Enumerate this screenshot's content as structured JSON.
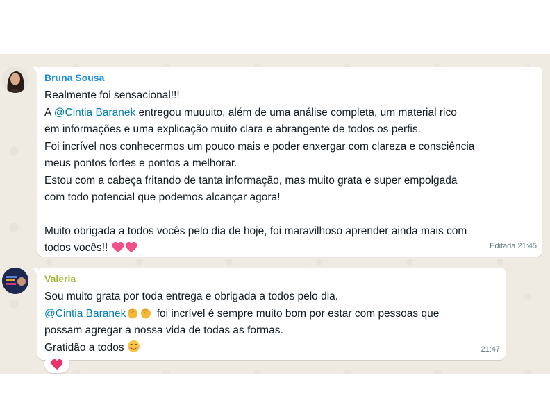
{
  "messages": [
    {
      "sender": "Bruna Sousa",
      "sender_color": "#1f8fdc",
      "lines": {
        "l1": "Realmente foi sensacional!!!",
        "l2_prefix": "A ",
        "l2_mention": "@Cintia Baranek",
        "l2_rest": " entregou muuuito, além de uma análise completa, um material rico",
        "l3": "em informações e uma explicação muito clara e abrangente de todos os perfis.",
        "l4": "Foi incrível nos conhecermos um pouco mais e poder enxergar com clareza e consciência",
        "l5": "meus pontos fortes e pontos a melhorar.",
        "l6": "Estou com a cabeça fritando de tanta informação, mas muito grata e super empolgada",
        "l7": "com todo potencial que podemos alcançar agora!",
        "l8": "Muito obrigada a todos vocês pelo dia de hoje, foi maravilhoso aprender ainda mais com",
        "l9": "todos vocês!! "
      },
      "meta": "Editada 21:45"
    },
    {
      "sender": "Valeria",
      "sender_color": "#a3b83a",
      "lines": {
        "l1": "Sou muito grata por toda entrega e obrigada a todos pelo dia.",
        "l2_mention": "@Cintia Baranek",
        "l2_rest": " foi incrível é sempre muito bom por estar com pessoas que",
        "l3": "possam agregar a nossa vida de todas as formas.",
        "l4": "Gratidão a todos "
      },
      "meta": "21:47",
      "reaction": "heart-icon"
    }
  ],
  "colors": {
    "chat_background": "#efeae2",
    "mention": "#027eb5",
    "heart": "#e8336b"
  }
}
